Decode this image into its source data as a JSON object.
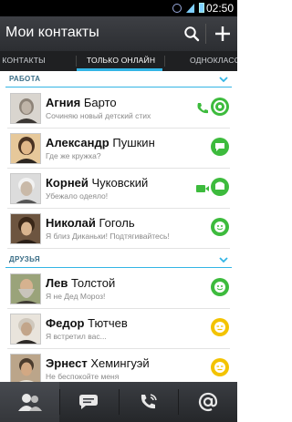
{
  "status_bar": {
    "time": "02:50"
  },
  "action_bar": {
    "title": "Мои контакты"
  },
  "tabs": [
    {
      "label": "Е КОНТАКТЫ"
    },
    {
      "label": "ТОЛЬКО ОНЛАЙН"
    },
    {
      "label": "ОДНОКЛАСС"
    }
  ],
  "groups": [
    {
      "label": "РАБОТА",
      "contacts": [
        {
          "first": "Агния",
          "last": "Барто",
          "status_text": "Сочиняю новый детский стих",
          "channel": "phone",
          "presence": "online"
        },
        {
          "first": "Александр",
          "last": "Пушкин",
          "status_text": "Где же кружка?",
          "channel": "",
          "presence": "chat"
        },
        {
          "first": "Корней",
          "last": "Чуковский",
          "status_text": "Убежало одеяло!",
          "channel": "video",
          "presence": "online"
        },
        {
          "first": "Николай",
          "last": "Гоголь",
          "status_text": "Я близ Диканьки! Подтягивайтесь!",
          "channel": "",
          "presence": "happy"
        }
      ]
    },
    {
      "label": "ДРУЗЬЯ",
      "contacts": [
        {
          "first": "Лев",
          "last": "Толстой",
          "status_text": "Я не Дед Мороз!",
          "channel": "",
          "presence": "happy"
        },
        {
          "first": "Федор",
          "last": "Тютчев",
          "status_text": "Я встретил вас...",
          "channel": "",
          "presence": "away"
        },
        {
          "first": "Эрнест",
          "last": "Хемингуэй",
          "status_text": "Не беспокойте меня",
          "channel": "",
          "presence": "away"
        }
      ]
    }
  ],
  "bottom_nav": [
    {
      "icon": "contacts-icon",
      "active": true
    },
    {
      "icon": "chats-icon",
      "active": false
    },
    {
      "icon": "calls-icon",
      "active": false
    },
    {
      "icon": "email-icon",
      "active": false
    }
  ],
  "colors": {
    "accent": "#33b5e5",
    "online": "#3dbb3d",
    "away": "#f3c300",
    "section_text": "#3a6d86"
  }
}
